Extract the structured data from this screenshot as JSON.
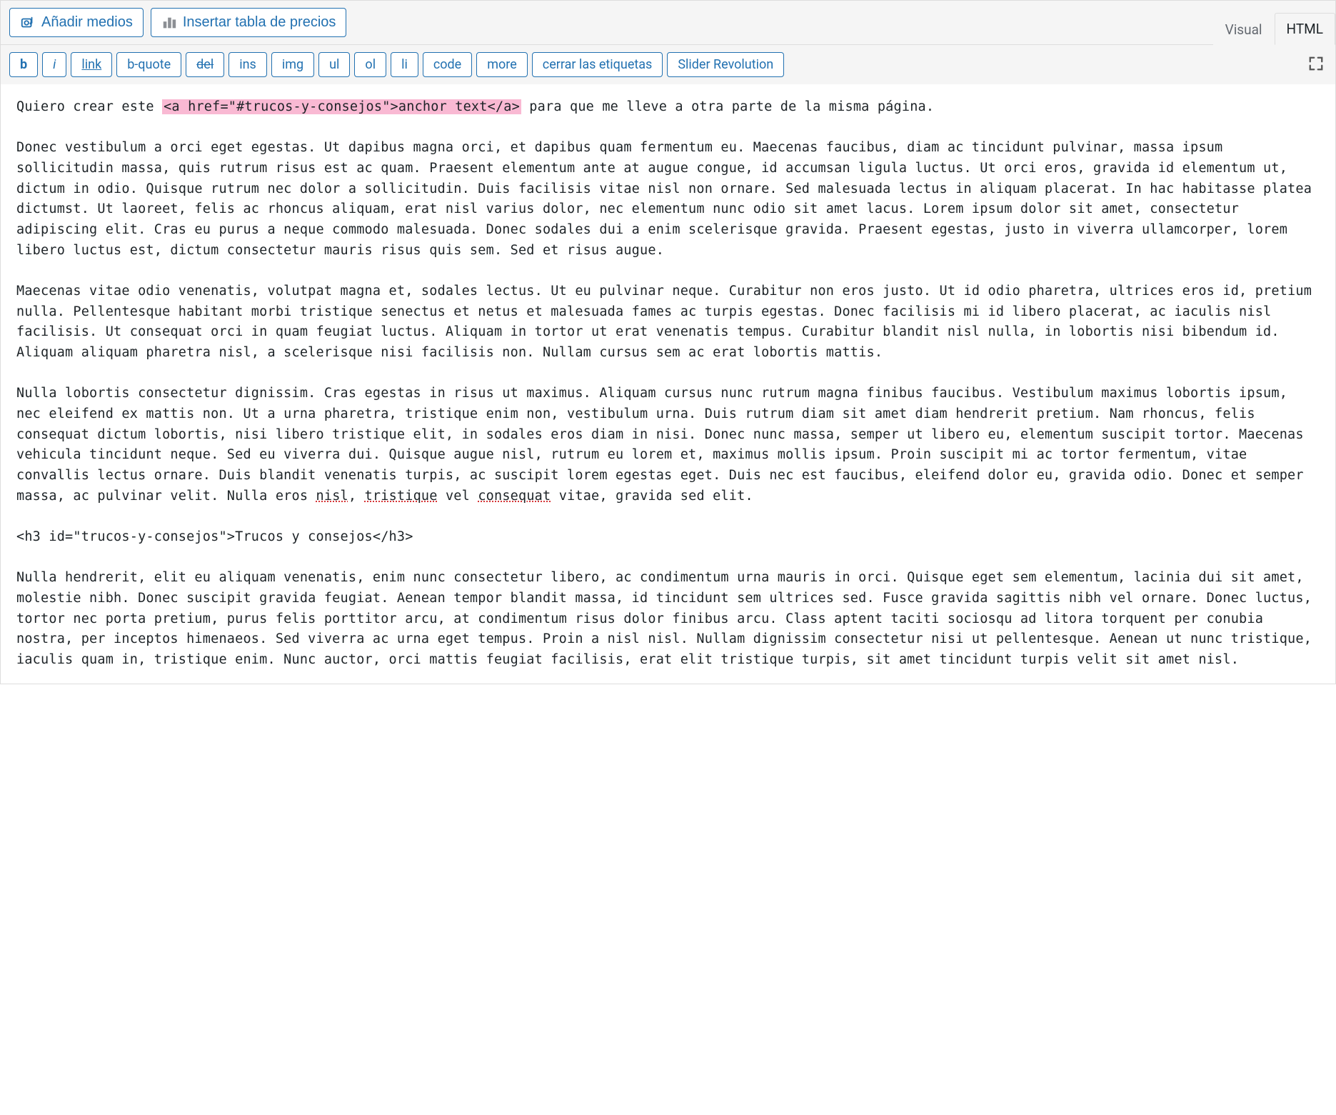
{
  "top": {
    "add_media": "Añadir medios",
    "insert_price_table": "Insertar tabla de precios",
    "tab_visual": "Visual",
    "tab_html": "HTML"
  },
  "qt": {
    "b": "b",
    "i": "i",
    "link": "link",
    "bquote": "b-quote",
    "del": "del",
    "ins": "ins",
    "img": "img",
    "ul": "ul",
    "ol": "ol",
    "li": "li",
    "code": "code",
    "more": "more",
    "close": "cerrar las etiquetas",
    "slider": "Slider Revolution"
  },
  "content": {
    "line1_pre": "Quiero crear este ",
    "line1_hl": "<a href=\"#trucos-y-consejos\">anchor text</a>",
    "line1_post": " para que me lleve a otra parte de la misma página.",
    "p2": "Donec vestibulum a orci eget egestas. Ut dapibus magna orci, et dapibus quam fermentum eu. Maecenas faucibus, diam ac tincidunt pulvinar, massa ipsum sollicitudin massa, quis rutrum risus est ac quam. Praesent elementum ante at augue congue, id accumsan ligula luctus. Ut orci eros, gravida id elementum ut, dictum in odio. Quisque rutrum nec dolor a sollicitudin. Duis facilisis vitae nisl non ornare. Sed malesuada lectus in aliquam placerat. In hac habitasse platea dictumst. Ut laoreet, felis ac rhoncus aliquam, erat nisl varius dolor, nec elementum nunc odio sit amet lacus. Lorem ipsum dolor sit amet, consectetur adipiscing elit. Cras eu purus a neque commodo malesuada. Donec sodales dui a enim scelerisque gravida. Praesent egestas, justo in viverra ullamcorper, lorem libero luctus est, dictum consectetur mauris risus quis sem. Sed et risus augue.",
    "p3": "Maecenas vitae odio venenatis, volutpat magna et, sodales lectus. Ut eu pulvinar neque. Curabitur non eros justo. Ut id odio pharetra, ultrices eros id, pretium nulla. Pellentesque habitant morbi tristique senectus et netus et malesuada fames ac turpis egestas. Donec facilisis mi id libero placerat, ac iaculis nisl facilisis. Ut consequat orci in quam feugiat luctus. Aliquam in tortor ut erat venenatis tempus. Curabitur blandit nisl nulla, in lobortis nisi bibendum id. Aliquam aliquam pharetra nisl, a scelerisque nisi facilisis non. Nullam cursus sem ac erat lobortis mattis.",
    "p4_pre": "Nulla lobortis consectetur dignissim. Cras egestas in risus ut maximus. Aliquam cursus nunc rutrum magna finibus faucibus. Vestibulum maximus lobortis ipsum, nec eleifend ex mattis non. Ut a urna pharetra, tristique enim non, vestibulum urna. Duis rutrum diam sit amet diam hendrerit pretium. Nam rhoncus, felis consequat dictum lobortis, nisi libero tristique elit, in sodales eros diam in nisi. Donec nunc massa, semper ut libero eu, elementum suscipit tortor. Maecenas vehicula tincidunt neque. Sed eu viverra dui. Quisque augue nisl, rutrum eu lorem et, maximus mollis ipsum. Proin suscipit mi ac tortor fermentum, vitae convallis lectus ornare. Duis blandit venenatis turpis, ac suscipit lorem egestas eget. Duis nec est faucibus, eleifend dolor eu, gravida odio. Donec et semper massa, ac pulvinar velit. Nulla eros ",
    "p4_err1": "nisl",
    "p4_mid1": ", ",
    "p4_err2": "tristique",
    "p4_mid2": " vel ",
    "p4_err3": "consequat",
    "p4_post": " vitae, gravida sed elit.",
    "h3": "<h3 id=\"trucos-y-consejos\">Trucos y consejos</h3>",
    "p5": "Nulla hendrerit, elit eu aliquam venenatis, enim nunc consectetur libero, ac condimentum urna mauris in orci. Quisque eget sem elementum, lacinia dui sit amet, molestie nibh. Donec suscipit gravida feugiat. Aenean tempor blandit massa, id tincidunt sem ultrices sed. Fusce gravida sagittis nibh vel ornare. Donec luctus, tortor nec porta pretium, purus felis porttitor arcu, at condimentum risus dolor finibus arcu. Class aptent taciti sociosqu ad litora torquent per conubia nostra, per inceptos himenaeos. Sed viverra ac urna eget tempus. Proin a nisl nisl. Nullam dignissim consectetur nisi ut pellentesque. Aenean ut nunc tristique, iaculis quam in, tristique enim. Nunc auctor, orci mattis feugiat facilisis, erat elit tristique turpis, sit amet tincidunt turpis velit sit amet nisl."
  }
}
